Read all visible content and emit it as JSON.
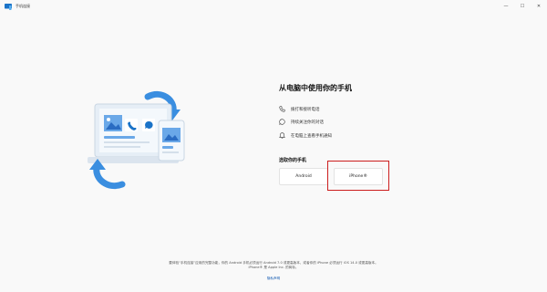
{
  "window": {
    "title": "手机连接",
    "minimize": "—",
    "maximize": "☐",
    "close": "✕"
  },
  "main": {
    "heading": "从电脑中使用你的手机",
    "features": [
      {
        "icon": "phone-icon",
        "label": "拨打和接听电话"
      },
      {
        "icon": "chat-bubble-icon",
        "label": "持续关注你的对话"
      },
      {
        "icon": "bell-icon",
        "label": "在电脑上查看手机通知"
      }
    ],
    "select_label": "选取你的手机",
    "android_button": "Android",
    "iphone_button": "iPhone®"
  },
  "footer": {
    "line1": "要体验“手机连接”应用的完整功能，你的 Android 手机必须运行 Android 7.0 或更高版本，或者你的 iPhone 必须运行 iOS 14.0 或更高版本。",
    "line2": "iPhone® 是 Apple Inc. 的商标。",
    "link": "隐私声明"
  },
  "colors": {
    "accent": "#1a73c8",
    "highlight": "#cc1e1e"
  }
}
